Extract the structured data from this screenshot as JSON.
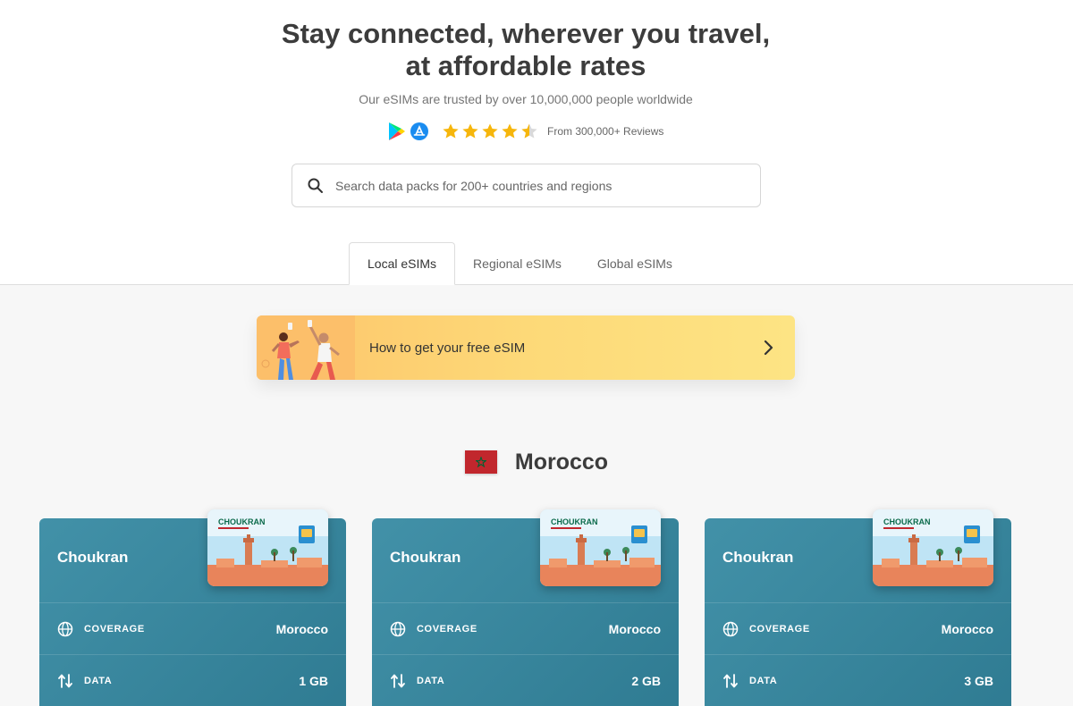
{
  "hero": {
    "title_line1": "Stay connected, wherever you travel,",
    "title_line2": "at affordable rates",
    "subtitle": "Our eSIMs are trusted by over 10,000,000 people worldwide",
    "rating": 4.5,
    "reviews": "From 300,000+ Reviews",
    "icons": [
      "google-play-icon",
      "app-store-icon"
    ]
  },
  "search": {
    "placeholder": "Search data packs for 200+ countries and regions"
  },
  "tabs": [
    {
      "label": "Local eSIMs",
      "active": true
    },
    {
      "label": "Regional eSIMs",
      "active": false
    },
    {
      "label": "Global eSIMs",
      "active": false
    }
  ],
  "promo": {
    "label": "How to get your free eSIM"
  },
  "country": {
    "name": "Morocco",
    "flag_color": "#c1272d",
    "star_color": "#006233"
  },
  "sim_brand": "CHOUKRAN",
  "cards": [
    {
      "name": "Choukran",
      "coverage_label": "COVERAGE",
      "coverage": "Morocco",
      "data_label": "DATA",
      "data": "1 GB"
    },
    {
      "name": "Choukran",
      "coverage_label": "COVERAGE",
      "coverage": "Morocco",
      "data_label": "DATA",
      "data": "2 GB"
    },
    {
      "name": "Choukran",
      "coverage_label": "COVERAGE",
      "coverage": "Morocco",
      "data_label": "DATA",
      "data": "3 GB"
    }
  ],
  "colors": {
    "card": "#3a8aa2",
    "star": "#f6b60c",
    "promo": "#fdd978"
  }
}
